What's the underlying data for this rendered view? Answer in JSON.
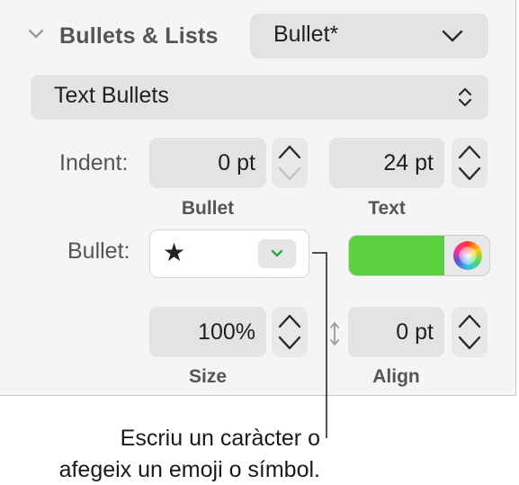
{
  "section": {
    "title": "Bullets & Lists",
    "style_popup_value": "Bullet*"
  },
  "bullet_type_popup": {
    "value": "Text Bullets"
  },
  "indent": {
    "label": "Indent:",
    "bullet_value": "0 pt",
    "bullet_sublabel": "Bullet",
    "text_value": "24 pt",
    "text_sublabel": "Text"
  },
  "bullet": {
    "label": "Bullet:",
    "character": "★",
    "color": "#5ad13f"
  },
  "size_align": {
    "size_value": "100%",
    "size_sublabel": "Size",
    "align_value": "0 pt",
    "align_sublabel": "Align"
  },
  "callout": {
    "line1": "Escriu un caràcter o",
    "line2": "afegeix un emoji o símbol."
  },
  "colors": {
    "panel_bg": "#f5f5f5",
    "control_bg": "#e3e3e3",
    "label_gray": "#555555",
    "accent_green": "#2aa84a"
  },
  "icons": [
    "chevron-down-icon",
    "chevron-down-icon",
    "updown-chevron-icon",
    "stepper-icon",
    "star-icon",
    "color-wheel-icon",
    "vertical-arrows-icon"
  ]
}
